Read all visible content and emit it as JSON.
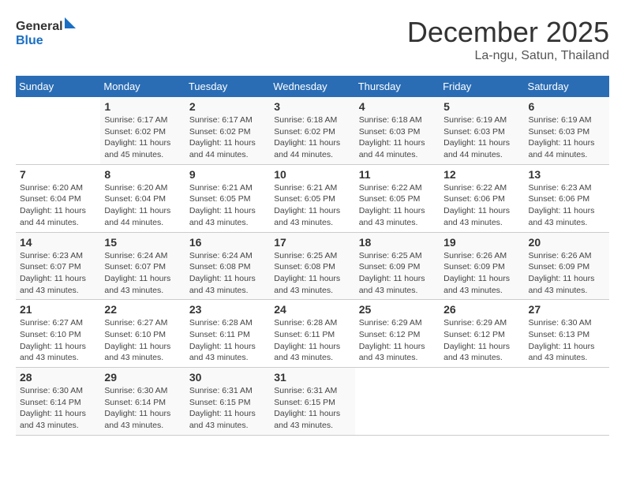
{
  "logo": {
    "line1": "General",
    "line2": "Blue"
  },
  "title": "December 2025",
  "subtitle": "La-ngu, Satun, Thailand",
  "days_of_week": [
    "Sunday",
    "Monday",
    "Tuesday",
    "Wednesday",
    "Thursday",
    "Friday",
    "Saturday"
  ],
  "weeks": [
    [
      {
        "day": "",
        "info": ""
      },
      {
        "day": "1",
        "info": "Sunrise: 6:17 AM\nSunset: 6:02 PM\nDaylight: 11 hours\nand 45 minutes."
      },
      {
        "day": "2",
        "info": "Sunrise: 6:17 AM\nSunset: 6:02 PM\nDaylight: 11 hours\nand 44 minutes."
      },
      {
        "day": "3",
        "info": "Sunrise: 6:18 AM\nSunset: 6:02 PM\nDaylight: 11 hours\nand 44 minutes."
      },
      {
        "day": "4",
        "info": "Sunrise: 6:18 AM\nSunset: 6:03 PM\nDaylight: 11 hours\nand 44 minutes."
      },
      {
        "day": "5",
        "info": "Sunrise: 6:19 AM\nSunset: 6:03 PM\nDaylight: 11 hours\nand 44 minutes."
      },
      {
        "day": "6",
        "info": "Sunrise: 6:19 AM\nSunset: 6:03 PM\nDaylight: 11 hours\nand 44 minutes."
      }
    ],
    [
      {
        "day": "7",
        "info": "Sunrise: 6:20 AM\nSunset: 6:04 PM\nDaylight: 11 hours\nand 44 minutes."
      },
      {
        "day": "8",
        "info": "Sunrise: 6:20 AM\nSunset: 6:04 PM\nDaylight: 11 hours\nand 44 minutes."
      },
      {
        "day": "9",
        "info": "Sunrise: 6:21 AM\nSunset: 6:05 PM\nDaylight: 11 hours\nand 43 minutes."
      },
      {
        "day": "10",
        "info": "Sunrise: 6:21 AM\nSunset: 6:05 PM\nDaylight: 11 hours\nand 43 minutes."
      },
      {
        "day": "11",
        "info": "Sunrise: 6:22 AM\nSunset: 6:05 PM\nDaylight: 11 hours\nand 43 minutes."
      },
      {
        "day": "12",
        "info": "Sunrise: 6:22 AM\nSunset: 6:06 PM\nDaylight: 11 hours\nand 43 minutes."
      },
      {
        "day": "13",
        "info": "Sunrise: 6:23 AM\nSunset: 6:06 PM\nDaylight: 11 hours\nand 43 minutes."
      }
    ],
    [
      {
        "day": "14",
        "info": "Sunrise: 6:23 AM\nSunset: 6:07 PM\nDaylight: 11 hours\nand 43 minutes."
      },
      {
        "day": "15",
        "info": "Sunrise: 6:24 AM\nSunset: 6:07 PM\nDaylight: 11 hours\nand 43 minutes."
      },
      {
        "day": "16",
        "info": "Sunrise: 6:24 AM\nSunset: 6:08 PM\nDaylight: 11 hours\nand 43 minutes."
      },
      {
        "day": "17",
        "info": "Sunrise: 6:25 AM\nSunset: 6:08 PM\nDaylight: 11 hours\nand 43 minutes."
      },
      {
        "day": "18",
        "info": "Sunrise: 6:25 AM\nSunset: 6:09 PM\nDaylight: 11 hours\nand 43 minutes."
      },
      {
        "day": "19",
        "info": "Sunrise: 6:26 AM\nSunset: 6:09 PM\nDaylight: 11 hours\nand 43 minutes."
      },
      {
        "day": "20",
        "info": "Sunrise: 6:26 AM\nSunset: 6:09 PM\nDaylight: 11 hours\nand 43 minutes."
      }
    ],
    [
      {
        "day": "21",
        "info": "Sunrise: 6:27 AM\nSunset: 6:10 PM\nDaylight: 11 hours\nand 43 minutes."
      },
      {
        "day": "22",
        "info": "Sunrise: 6:27 AM\nSunset: 6:10 PM\nDaylight: 11 hours\nand 43 minutes."
      },
      {
        "day": "23",
        "info": "Sunrise: 6:28 AM\nSunset: 6:11 PM\nDaylight: 11 hours\nand 43 minutes."
      },
      {
        "day": "24",
        "info": "Sunrise: 6:28 AM\nSunset: 6:11 PM\nDaylight: 11 hours\nand 43 minutes."
      },
      {
        "day": "25",
        "info": "Sunrise: 6:29 AM\nSunset: 6:12 PM\nDaylight: 11 hours\nand 43 minutes."
      },
      {
        "day": "26",
        "info": "Sunrise: 6:29 AM\nSunset: 6:12 PM\nDaylight: 11 hours\nand 43 minutes."
      },
      {
        "day": "27",
        "info": "Sunrise: 6:30 AM\nSunset: 6:13 PM\nDaylight: 11 hours\nand 43 minutes."
      }
    ],
    [
      {
        "day": "28",
        "info": "Sunrise: 6:30 AM\nSunset: 6:14 PM\nDaylight: 11 hours\nand 43 minutes."
      },
      {
        "day": "29",
        "info": "Sunrise: 6:30 AM\nSunset: 6:14 PM\nDaylight: 11 hours\nand 43 minutes."
      },
      {
        "day": "30",
        "info": "Sunrise: 6:31 AM\nSunset: 6:15 PM\nDaylight: 11 hours\nand 43 minutes."
      },
      {
        "day": "31",
        "info": "Sunrise: 6:31 AM\nSunset: 6:15 PM\nDaylight: 11 hours\nand 43 minutes."
      },
      {
        "day": "",
        "info": ""
      },
      {
        "day": "",
        "info": ""
      },
      {
        "day": "",
        "info": ""
      }
    ]
  ]
}
